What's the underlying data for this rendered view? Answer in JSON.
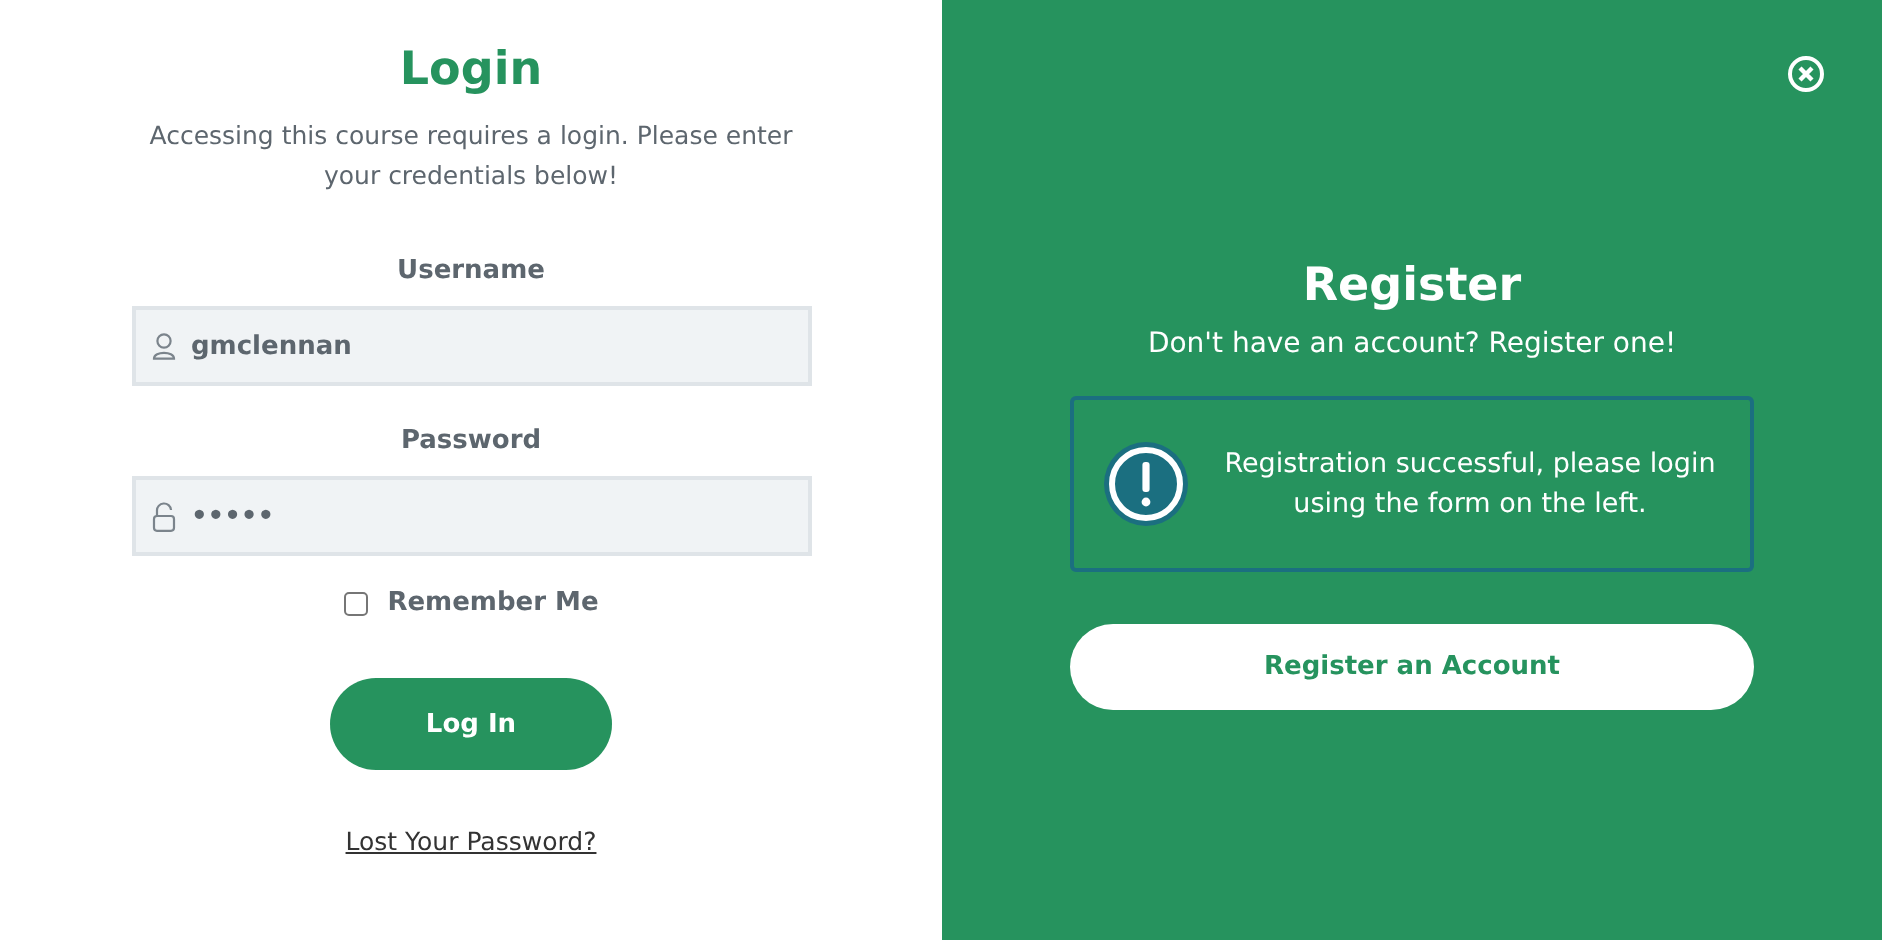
{
  "login": {
    "title": "Login",
    "intro": "Accessing this course requires a login. Please enter your credentials below!",
    "fields": [
      {
        "kind": "user",
        "label": "Username",
        "value": "gmclennan"
      },
      {
        "kind": "lock",
        "label": "Password",
        "value": "•••••"
      }
    ],
    "remember": {
      "label": "Remember Me",
      "checked": false
    },
    "button": "Log In",
    "link": "Lost Your Password?"
  },
  "register": {
    "title": "Register",
    "subtitle": "Don't have an account? Register one!",
    "notice": "Registration successful, please login using the form on the left.",
    "button": "Register an Account"
  }
}
